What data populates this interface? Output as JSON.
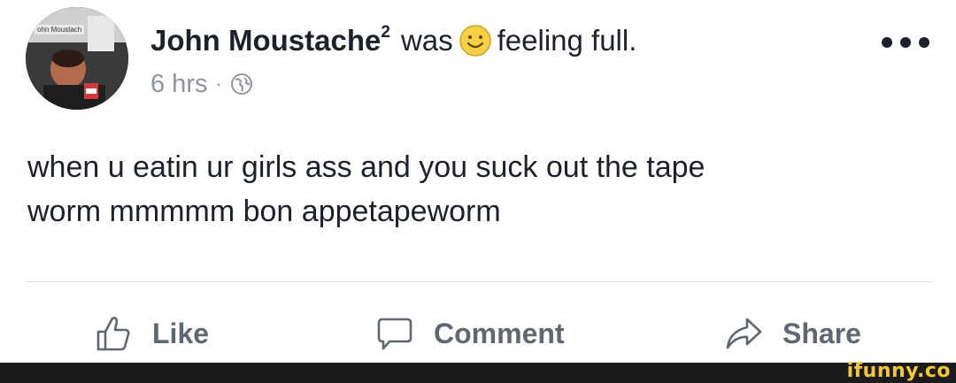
{
  "post": {
    "avatar_caption": "ohn Moustach",
    "author": "John Moustache",
    "author_superscript": "2",
    "activity_verb": "was",
    "activity_emoji": "smiling-face-icon",
    "activity_text": "feeling full.",
    "timestamp": "6 hrs",
    "separator": "·",
    "audience_icon": "globe-icon",
    "more_icon": "more-options-icon",
    "text": "when u eatin ur girls ass and you suck out the tape\nworm mmmmm bon appetapeworm"
  },
  "actions": {
    "like_label": "Like",
    "comment_label": "Comment",
    "share_label": "Share"
  },
  "watermark": {
    "text": "ifunny.co"
  },
  "colors": {
    "text": "#1d2129",
    "muted": "#90949c",
    "action": "#616770",
    "emoji": "#f7d046",
    "watermark": "#f6c933",
    "watermark_bar": "#1b1b1b"
  }
}
